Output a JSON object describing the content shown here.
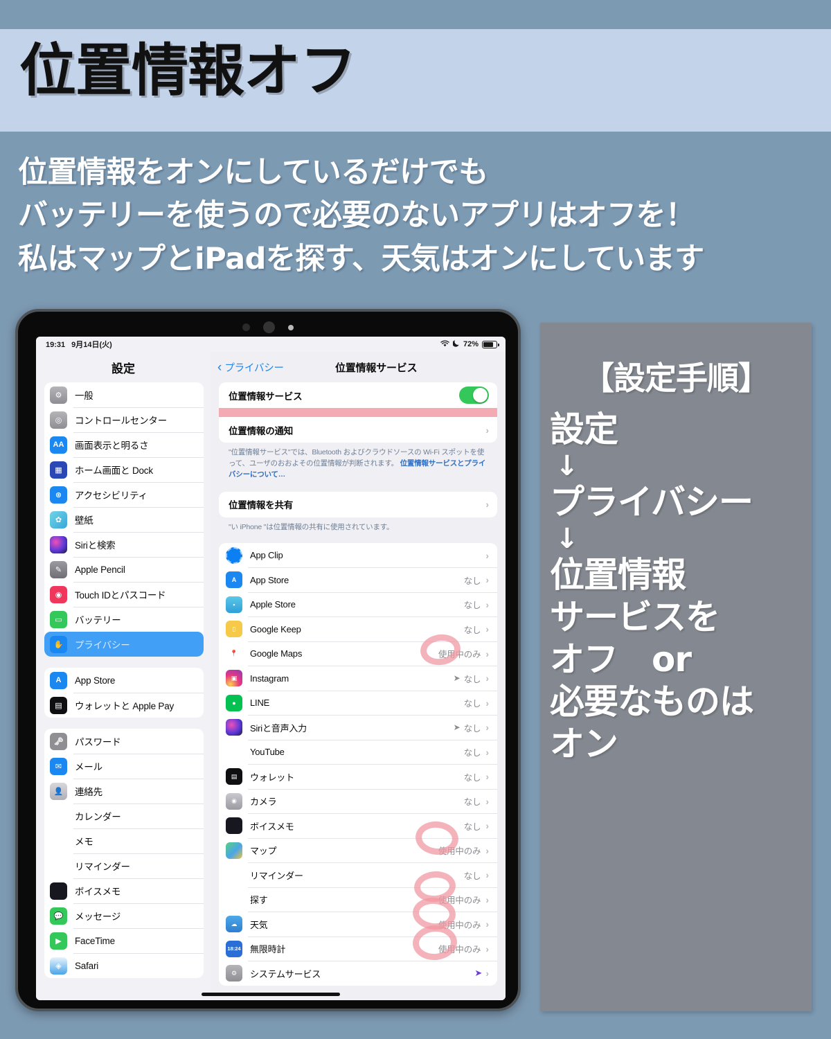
{
  "banner": {
    "title": "位置情報オフ"
  },
  "subtitle": {
    "lines": [
      "位置情報をオンにしているだけでも",
      "バッテリーを使うので必要のないアプリはオフを！",
      "私はマップとiPadを探す、天気はオンにしています"
    ]
  },
  "colors": {
    "top_strip": "#7d9ab3",
    "title_band": "#c3d3e9",
    "steps_panel": "#848890",
    "toggle_on": "#34c759",
    "highlight_row": "#41a0f5",
    "annotation_pink": "#f096a0",
    "pink_bar": "#f3aab2",
    "ios_link_blue": "#1b87f0"
  },
  "ipad": {
    "statusbar": {
      "time": "19:31",
      "date": "9月14日(火)",
      "wifi_icon": "wifi-icon",
      "moon_icon": "moon-icon",
      "battery_percent": "72%",
      "battery_level": 72
    },
    "sidebar": {
      "header": "設定",
      "groups": [
        {
          "items": [
            {
              "label": "一般",
              "icon": "gear-icon",
              "icon_class": "ic-grad-gray",
              "glyph": "⚙",
              "selected": false
            },
            {
              "label": "コントロールセンター",
              "icon": "control-center-icon",
              "icon_class": "ic-control",
              "glyph": "◎",
              "selected": false
            },
            {
              "label": "画面表示と明るさ",
              "icon": "display-brightness-icon",
              "icon_class": "ic-display",
              "glyph": "AA",
              "selected": false
            },
            {
              "label": "ホーム画面と Dock",
              "icon": "home-screen-dock-icon",
              "icon_class": "ic-darkblue",
              "glyph": "▦",
              "selected": false
            },
            {
              "label": "アクセシビリティ",
              "icon": "accessibility-icon",
              "icon_class": "ic-accessible",
              "glyph": "⊛",
              "selected": false
            },
            {
              "label": "壁紙",
              "icon": "wallpaper-icon",
              "icon_class": "ic-wallpaper",
              "glyph": "✿",
              "selected": false
            },
            {
              "label": "Siriと検索",
              "icon": "siri-icon",
              "icon_class": "ic-siri",
              "glyph": "",
              "selected": false
            },
            {
              "label": "Apple Pencil",
              "icon": "apple-pencil-icon",
              "icon_class": "ic-pencil",
              "glyph": "✎",
              "selected": false
            },
            {
              "label": "Touch IDとパスコード",
              "icon": "touch-id-icon",
              "icon_class": "ic-touchid",
              "glyph": "◉",
              "selected": false
            },
            {
              "label": "バッテリー",
              "icon": "battery-icon",
              "icon_class": "ic-battery",
              "glyph": "▭",
              "selected": false
            },
            {
              "label": "プライバシー",
              "icon": "privacy-hand-icon",
              "icon_class": "ic-privacy",
              "glyph": "✋",
              "selected": true
            }
          ]
        },
        {
          "items": [
            {
              "label": "App Store",
              "icon": "app-store-icon",
              "icon_class": "ic-blue",
              "glyph": "A",
              "selected": false
            },
            {
              "label": "ウォレットと Apple Pay",
              "icon": "wallet-icon",
              "icon_class": "ic-wallet",
              "glyph": "▤",
              "selected": false
            }
          ]
        },
        {
          "items": [
            {
              "label": "パスワード",
              "icon": "password-key-icon",
              "icon_class": "ic-pass",
              "glyph": "🗝",
              "selected": false
            },
            {
              "label": "メール",
              "icon": "mail-icon",
              "icon_class": "ic-mail",
              "glyph": "✉",
              "selected": false
            },
            {
              "label": "連絡先",
              "icon": "contacts-icon",
              "icon_class": "ic-contacts",
              "glyph": "👤",
              "selected": false
            },
            {
              "label": "カレンダー",
              "icon": "calendar-icon",
              "icon_class": "ic-calendar",
              "glyph": "",
              "selected": false
            },
            {
              "label": "メモ",
              "icon": "notes-icon",
              "icon_class": "ic-notes",
              "glyph": "",
              "selected": false
            },
            {
              "label": "リマインダー",
              "icon": "reminders-icon",
              "icon_class": "ic-reminders",
              "glyph": "",
              "selected": false
            },
            {
              "label": "ボイスメモ",
              "icon": "voice-memos-icon",
              "icon_class": "ic-voice",
              "glyph": "",
              "selected": false
            },
            {
              "label": "メッセージ",
              "icon": "messages-icon",
              "icon_class": "ic-msg",
              "glyph": "💬",
              "selected": false
            },
            {
              "label": "FaceTime",
              "icon": "facetime-icon",
              "icon_class": "ic-facetime",
              "glyph": "▶",
              "selected": false
            },
            {
              "label": "Safari",
              "icon": "safari-icon",
              "icon_class": "ic-safari",
              "glyph": "◈",
              "selected": false
            }
          ]
        }
      ]
    },
    "detail": {
      "back_label": "プライバシー",
      "title": "位置情報サービス",
      "location_services_row": {
        "label": "位置情報サービス",
        "toggle_state": "on"
      },
      "location_alerts_row": {
        "label": "位置情報の通知"
      },
      "footnote_1": {
        "text_a": "\"位置情報サービス\"では、Bluetooth およびクラウドソースの Wi-Fi スポットを使って、ユーザのおおよその位置情報が判断されます。",
        "link": "位置情報サービスとプライバシーについて…"
      },
      "share_location_row": {
        "label": "位置情報を共有"
      },
      "footnote_2": "\"い iPhone \"は位置情報の共有に使用されています。",
      "apps": [
        {
          "name": "App Clip",
          "value": "",
          "icon": "app-clip-icon",
          "icon_class": "ic-appclip",
          "glyph": "",
          "arrow": ""
        },
        {
          "name": "App Store",
          "value": "なし",
          "icon": "app-store-icon",
          "icon_class": "ic-blue",
          "glyph": "A",
          "arrow": ""
        },
        {
          "name": "Apple Store",
          "value": "なし",
          "icon": "apple-store-icon",
          "icon_class": "ic-applestore",
          "glyph": "▪",
          "arrow": ""
        },
        {
          "name": "Google Keep",
          "value": "なし",
          "icon": "google-keep-icon",
          "icon_class": "ic-gkeep",
          "glyph": "▯",
          "arrow": ""
        },
        {
          "name": "Google Maps",
          "value": "使用中のみ",
          "icon": "google-maps-icon",
          "icon_class": "ic-gmaps",
          "glyph": "📍",
          "arrow": ""
        },
        {
          "name": "Instagram",
          "value": "なし",
          "icon": "instagram-icon",
          "icon_class": "ic-insta",
          "glyph": "▣",
          "arrow": "➤"
        },
        {
          "name": "LINE",
          "value": "なし",
          "icon": "line-icon",
          "icon_class": "ic-line",
          "glyph": "●",
          "arrow": ""
        },
        {
          "name": "Siriと音声入力",
          "value": "なし",
          "icon": "siri-icon",
          "icon_class": "ic-siri",
          "glyph": "",
          "arrow": "➤"
        },
        {
          "name": "YouTube",
          "value": "なし",
          "icon": "youtube-icon",
          "icon_class": "ic-youtube",
          "glyph": "▶",
          "arrow": ""
        },
        {
          "name": "ウォレット",
          "value": "なし",
          "icon": "wallet-icon",
          "icon_class": "ic-wallet",
          "glyph": "▤",
          "arrow": ""
        },
        {
          "name": "カメラ",
          "value": "なし",
          "icon": "camera-icon",
          "icon_class": "ic-camera",
          "glyph": "◉",
          "arrow": ""
        },
        {
          "name": "ボイスメモ",
          "value": "なし",
          "icon": "voice-memos-icon",
          "icon_class": "ic-voice",
          "glyph": "",
          "arrow": ""
        },
        {
          "name": "マップ",
          "value": "使用中のみ",
          "icon": "maps-icon",
          "icon_class": "ic-maps",
          "glyph": "",
          "arrow": ""
        },
        {
          "name": "リマインダー",
          "value": "なし",
          "icon": "reminders-icon",
          "icon_class": "ic-reminders",
          "glyph": "",
          "arrow": ""
        },
        {
          "name": "探す",
          "value": "使用中のみ",
          "icon": "find-my-icon",
          "icon_class": "ic-findmy",
          "glyph": "◎",
          "arrow": ""
        },
        {
          "name": "天気",
          "value": "使用中のみ",
          "icon": "weather-icon",
          "icon_class": "ic-weather",
          "glyph": "☁",
          "arrow": ""
        },
        {
          "name": "無限時計",
          "value": "使用中のみ",
          "icon": "clock-icon",
          "icon_class": "ic-clock18",
          "glyph": "18:24",
          "arrow": ""
        },
        {
          "name": "システムサービス",
          "value": "",
          "icon": "system-services-icon",
          "icon_class": "ic-sysserv",
          "glyph": "⚙",
          "arrow": "➤"
        }
      ]
    }
  },
  "steps": {
    "heading": "【設定手順】",
    "lines": [
      {
        "type": "text",
        "text": "設定"
      },
      {
        "type": "arrow",
        "text": "↓"
      },
      {
        "type": "text",
        "text": "プライバシー"
      },
      {
        "type": "arrow",
        "text": "↓"
      },
      {
        "type": "text",
        "text": "位置情報"
      },
      {
        "type": "text",
        "text": "サービスを"
      },
      {
        "type": "text",
        "text": "オフ　or"
      },
      {
        "type": "text",
        "text": "必要なものは"
      },
      {
        "type": "text",
        "text": "オン"
      }
    ]
  }
}
